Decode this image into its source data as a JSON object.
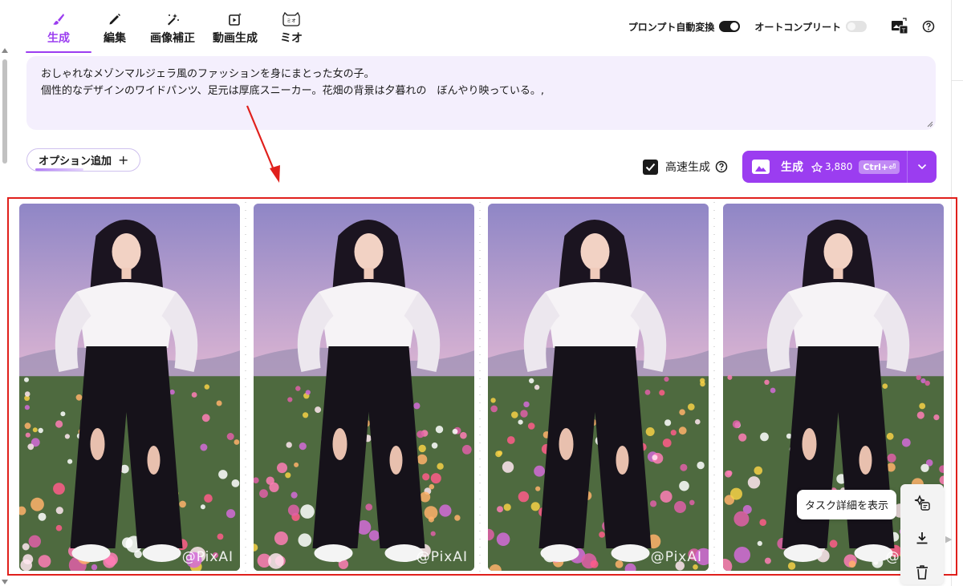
{
  "tabs": [
    {
      "label": "生成",
      "icon": "brush-icon",
      "active": true
    },
    {
      "label": "編集",
      "icon": "pencil-icon",
      "active": false
    },
    {
      "label": "画像補正",
      "icon": "magic-wand-icon",
      "active": false
    },
    {
      "label": "動画生成",
      "icon": "video-sparkle-icon",
      "active": false
    },
    {
      "label": "ミオ",
      "icon": "mio-cat-icon",
      "active": false
    }
  ],
  "mio_badge": "ミオ",
  "header": {
    "prompt_convert_label": "プロンプト自動変換",
    "prompt_convert_on": true,
    "autocomplete_label": "オートコンプリート",
    "autocomplete_on": false
  },
  "prompt": {
    "line1": "おしゃれなメゾンマルジェラ風のファッションを身にまとった女の子。",
    "line2": "個性的なデザインのワイドパンツ、足元は厚底スニーカー。花畑の背景は夕暮れの　ぼんやり映っている。,"
  },
  "options": {
    "add_label": "オプション追加",
    "add_icon": "plus-icon"
  },
  "fast_generation": {
    "label": "高速生成",
    "checked": true
  },
  "generate": {
    "label": "生成",
    "cost": "3,880",
    "shortcut": "Ctrl+⏎"
  },
  "images": [
    {
      "watermark": "@PixAI"
    },
    {
      "watermark": "@PixAI"
    },
    {
      "watermark": "@PixAI"
    },
    {
      "watermark": "@PixAI"
    }
  ],
  "tooltip": "タスク詳細を表示",
  "colors": {
    "accent": "#9b3df0",
    "highlight_frame": "#e0201c",
    "prompt_bg": "#f4effd"
  }
}
